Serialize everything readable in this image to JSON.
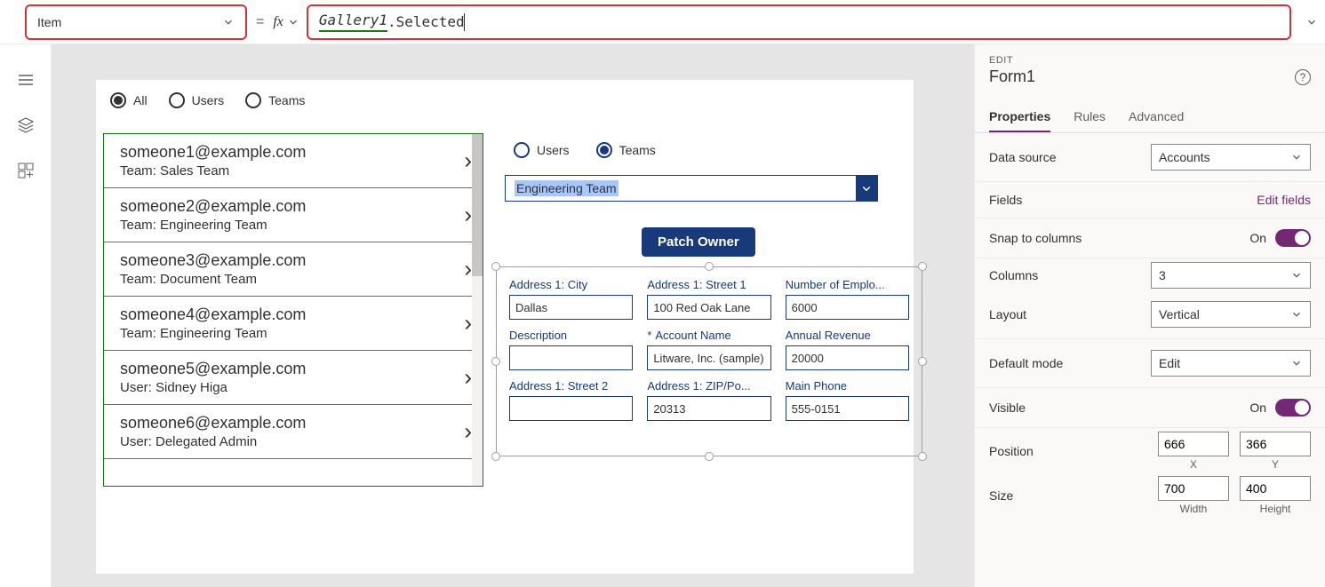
{
  "formulaBar": {
    "property": "Item",
    "fx": "fx",
    "formulaRef": "Gallery1",
    "formulaRest": ".Selected",
    "equals": "="
  },
  "filterRadios": {
    "all": "All",
    "users": "Users",
    "teams": "Teams"
  },
  "gallery": [
    {
      "title": "someone1@example.com",
      "sub": "Team: Sales Team"
    },
    {
      "title": "someone2@example.com",
      "sub": "Team: Engineering Team"
    },
    {
      "title": "someone3@example.com",
      "sub": "Team: Document Team"
    },
    {
      "title": "someone4@example.com",
      "sub": "Team: Engineering Team"
    },
    {
      "title": "someone5@example.com",
      "sub": "User: Sidney Higa"
    },
    {
      "title": "someone6@example.com",
      "sub": "User: Delegated Admin"
    }
  ],
  "formArea": {
    "radioUsers": "Users",
    "radioTeams": "Teams",
    "comboValue": "Engineering Team",
    "patchButton": "Patch Owner",
    "fields": [
      {
        "label": "Address 1: City",
        "value": "Dallas",
        "req": false
      },
      {
        "label": "Address 1: Street 1",
        "value": "100 Red Oak Lane",
        "req": false
      },
      {
        "label": "Number of Emplo...",
        "value": "6000",
        "req": false
      },
      {
        "label": "Description",
        "value": "",
        "req": false
      },
      {
        "label": "Account Name",
        "value": "Litware, Inc. (sample)",
        "req": true
      },
      {
        "label": "Annual Revenue",
        "value": "20000",
        "req": false
      },
      {
        "label": "Address 1: Street 2",
        "value": "",
        "req": false
      },
      {
        "label": "Address 1: ZIP/Po...",
        "value": "20313",
        "req": false
      },
      {
        "label": "Main Phone",
        "value": "555-0151",
        "req": false
      }
    ]
  },
  "rightPanel": {
    "editLabel": "EDIT",
    "controlName": "Form1",
    "tabs": {
      "properties": "Properties",
      "rules": "Rules",
      "advanced": "Advanced"
    },
    "dataSourceLabel": "Data source",
    "dataSourceValue": "Accounts",
    "fieldsLabel": "Fields",
    "editFields": "Edit fields",
    "snapLabel": "Snap to columns",
    "snapValue": "On",
    "columnsLabel": "Columns",
    "columnsValue": "3",
    "layoutLabel": "Layout",
    "layoutValue": "Vertical",
    "defaultModeLabel": "Default mode",
    "defaultModeValue": "Edit",
    "visibleLabel": "Visible",
    "visibleValue": "On",
    "positionLabel": "Position",
    "posX": "666",
    "posXl": "X",
    "posY": "366",
    "posYl": "Y",
    "sizeLabel": "Size",
    "sizeW": "700",
    "sizeWl": "Width",
    "sizeH": "400",
    "sizeHl": "Height"
  }
}
